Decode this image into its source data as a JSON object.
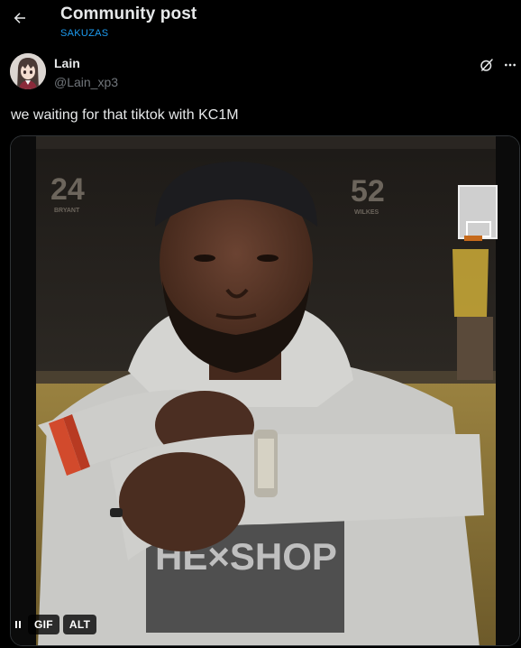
{
  "header": {
    "back_icon": "arrow-left-icon",
    "title": "Community post",
    "subtitle": "SAKUZAS"
  },
  "post": {
    "author": {
      "name": "Lain",
      "handle": "@Lain_xp3",
      "avatar_icon": "anime-girl-avatar"
    },
    "actions": {
      "grok_icon": "grok-icon",
      "more_icon": "more-horizontal-icon"
    },
    "text": "we waiting for that tiktok with KC1M",
    "media": {
      "type": "gif",
      "gif_label": "GIF",
      "alt_label": "ALT",
      "pause_icon": "pause-icon",
      "scene": {
        "jersey_left_number": "24",
        "jersey_left_name": "BRYANT",
        "jersey_right_number": "52",
        "jersey_right_name": "WILKES",
        "hoodie_print": "HE×SHOP"
      }
    }
  },
  "colors": {
    "background": "#000000",
    "text_primary": "#e7e9ea",
    "text_secondary": "#71767b",
    "accent": "#1d9bf0",
    "border": "#2f3336"
  }
}
